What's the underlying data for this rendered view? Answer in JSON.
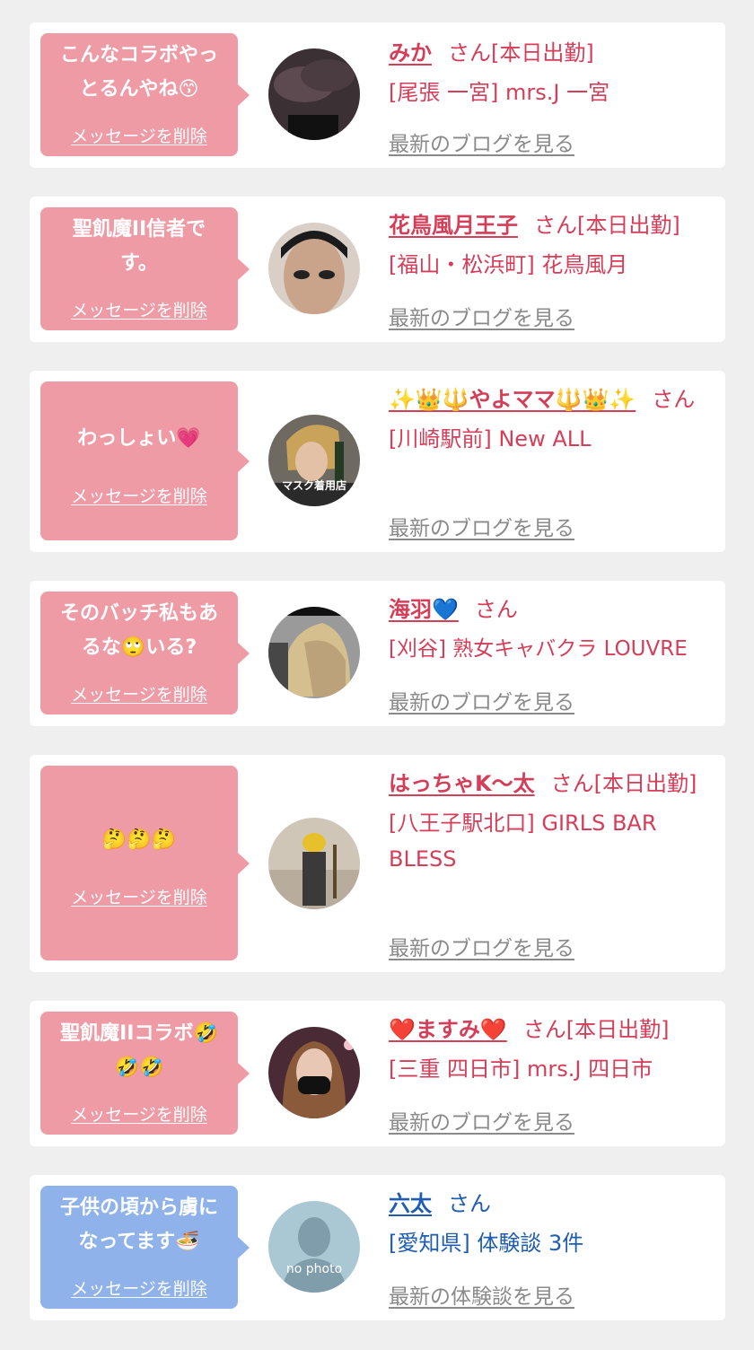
{
  "delete_label": "メッセージを削除",
  "san": "さん",
  "cards": [
    {
      "message_lines": [
        "こんなコラボやっ",
        "とるんやね😙"
      ],
      "name": "みか",
      "status": "[本日出勤]",
      "location": "[尾張 一宮] mrs.J 一宮",
      "link": "最新のブログを見る",
      "theme": "pink"
    },
    {
      "message_lines": [
        "聖飢魔II信者で",
        "す。"
      ],
      "name": "花鳥風月王子",
      "status": "[本日出勤]",
      "location": "[福山・松浜町] 花鳥風月",
      "link": "最新のブログを見る",
      "theme": "pink"
    },
    {
      "message_lines": [
        "わっしょい💗"
      ],
      "name": "✨👑🔱やよママ🔱👑✨",
      "status": "",
      "location": "[川崎駅前] New ALL",
      "avatar_caption": "マスク着用店",
      "link": "最新のブログを見る",
      "theme": "pink"
    },
    {
      "message_lines": [
        "そのバッチ私もあ",
        "るな🙄いる?"
      ],
      "name": "海羽💙",
      "status": "",
      "location": "[刈谷] 熟女キャバクラ LOUVRE",
      "link": "最新のブログを見る",
      "theme": "pink"
    },
    {
      "message_lines": [
        "🤔🤔🤔"
      ],
      "name": "はっちゃK〜太",
      "status": "[本日出勤]",
      "location": "[八王子駅北口] GIRLS BAR BLESS",
      "link": "最新のブログを見る",
      "theme": "pink"
    },
    {
      "message_lines": [
        "聖飢魔IIコラボ🤣",
        "🤣🤣"
      ],
      "name": "❤️ますみ❤️",
      "status": "[本日出勤]",
      "location": "[三重 四日市] mrs.J 四日市",
      "link": "最新のブログを見る",
      "theme": "pink"
    },
    {
      "message_lines": [
        "子供の頃から虜に",
        "なってます🍜"
      ],
      "name": "六太",
      "status": "",
      "location": "[愛知県] 体験談 3件",
      "avatar_caption": "no photo",
      "link": "最新の体験談を見る",
      "theme": "blue"
    }
  ]
}
